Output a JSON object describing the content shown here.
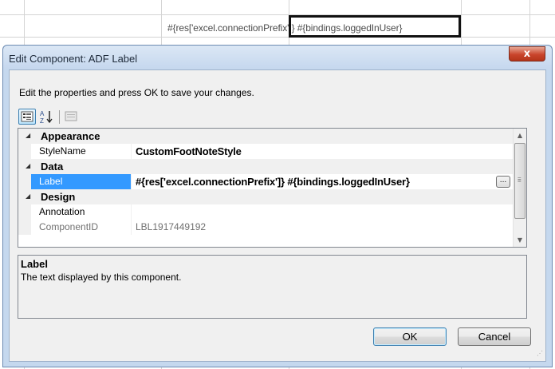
{
  "background_sheet": {
    "cell_text_left": "#{res['excel.connectio",
    "cell_text_right": "nPrefix']} #{bindings.loggedInUser}"
  },
  "dialog": {
    "title": "Edit Component: ADF Label",
    "close_label": "x",
    "instructions": "Edit the properties and press OK to save your changes.",
    "toolbar": {
      "categorized_icon": "categorized-view-icon",
      "alphabetical_icon": "sort-az-icon",
      "property_pages_icon": "property-pages-icon",
      "alpha_glyph": "A\nZ"
    },
    "property_grid": {
      "categories": [
        {
          "name": "Appearance",
          "properties": [
            {
              "name": "StyleName",
              "value": "CustomFootNoteStyle"
            }
          ]
        },
        {
          "name": "Data",
          "properties": [
            {
              "name": "Label",
              "value": "#{res['excel.connectionPrefix']} #{bindings.loggedInUser}",
              "button": "..."
            }
          ]
        },
        {
          "name": "Design",
          "properties": [
            {
              "name": "Annotation",
              "value": ""
            },
            {
              "name": "ComponentID",
              "value": "LBL1917449192"
            }
          ]
        }
      ]
    },
    "description": {
      "title": "Label",
      "text": "The text displayed by this component."
    },
    "buttons": {
      "ok": "OK",
      "cancel": "Cancel"
    }
  },
  "colors": {
    "selection": "#3399ff",
    "title_bar": "#c5d8ee",
    "close_button": "#c9452c"
  }
}
